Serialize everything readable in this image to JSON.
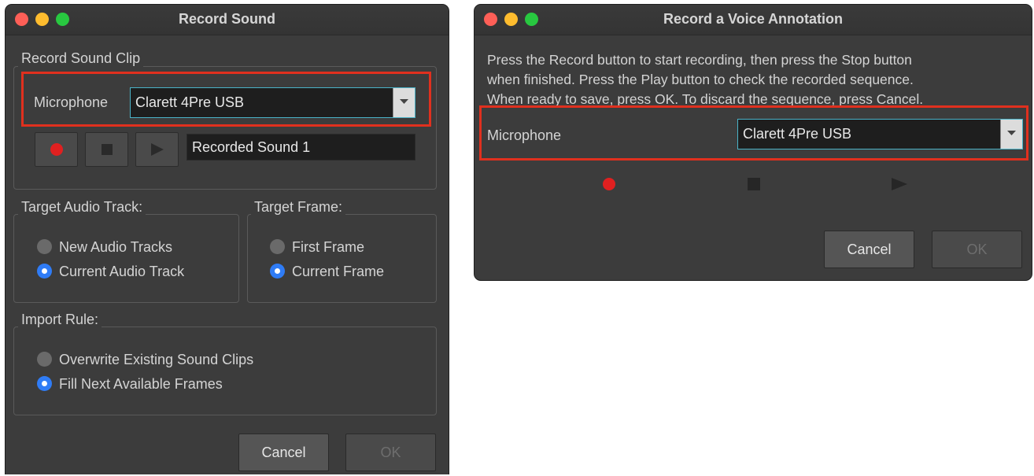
{
  "record_sound": {
    "title": "Record Sound",
    "clip_group_label": "Record Sound Clip",
    "microphone_label": "Microphone",
    "microphone_value": "Clarett 4Pre USB",
    "sound_name": "Recorded Sound 1",
    "target_track": {
      "label": "Target Audio Track:",
      "options": [
        "New Audio Tracks",
        "Current Audio Track"
      ],
      "selected": 1
    },
    "target_frame": {
      "label": "Target Frame:",
      "options": [
        "First Frame",
        "Current Frame"
      ],
      "selected": 1
    },
    "import_rule": {
      "label": "Import Rule:",
      "options": [
        "Overwrite Existing Sound Clips",
        "Fill Next Available Frames"
      ],
      "selected": 1
    },
    "cancel_label": "Cancel",
    "ok_label": "OK"
  },
  "voice_annotation": {
    "title": "Record a Voice Annotation",
    "instructions": [
      "Press the Record button to start recording, then press the Stop button",
      "when finished. Press the Play button to check the recorded sequence.",
      "When ready to save, press OK. To discard the sequence, press Cancel."
    ],
    "microphone_label": "Microphone",
    "microphone_value": "Clarett 4Pre USB",
    "cancel_label": "Cancel",
    "ok_label": "OK"
  },
  "colors": {
    "window_bg": "#3c3c3c",
    "highlight_box": "#e0301e",
    "record_dot": "#e02020",
    "radio_selected": "#2f7cf6",
    "select_border": "#4ab3c8"
  },
  "icons": [
    "close-icon",
    "minimize-icon",
    "zoom-icon",
    "record-icon",
    "stop-icon",
    "play-icon",
    "chevron-down-icon"
  ]
}
